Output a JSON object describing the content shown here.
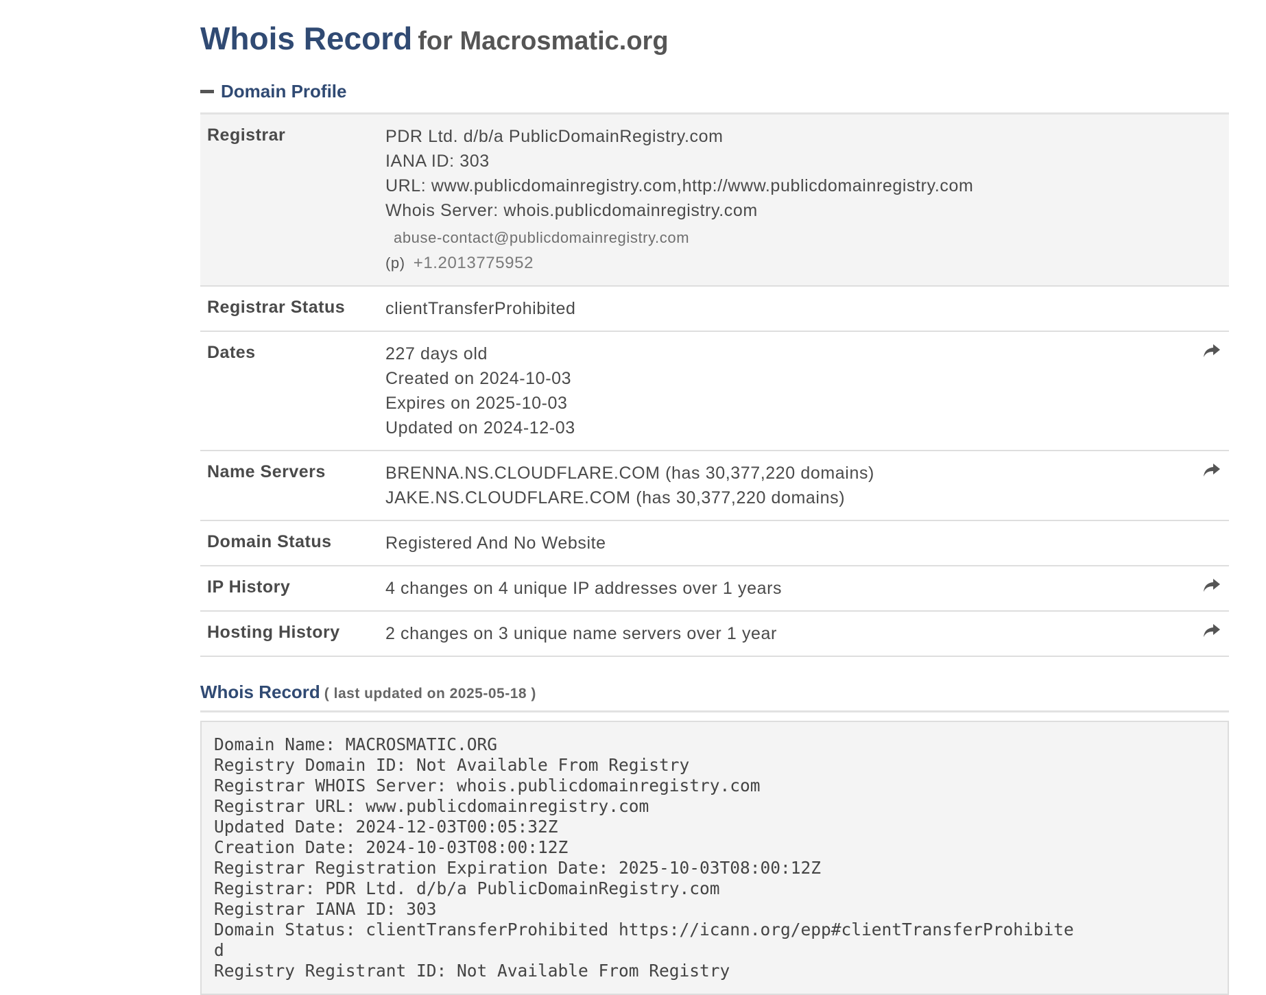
{
  "title": {
    "main": "Whois Record",
    "sub": "for Macrosmatic.org"
  },
  "profile_section": {
    "label": "Domain Profile",
    "rows": {
      "registrar": {
        "label": "Registrar",
        "name": "PDR Ltd. d/b/a PublicDomainRegistry.com",
        "iana": "IANA ID: 303",
        "url": "URL: www.publicdomainregistry.com,http://www.publicdomainregistry.com",
        "whois_server": "Whois Server: whois.publicdomainregistry.com",
        "email": "abuse-contact@publicdomainregistry.com",
        "phone_label": "(p)",
        "phone": "+1.2013775952"
      },
      "registrar_status": {
        "label": "Registrar Status",
        "value": "clientTransferProhibited"
      },
      "dates": {
        "label": "Dates",
        "age": "227 days old",
        "created": "Created on 2024-10-03",
        "expires": "Expires on 2025-10-03",
        "updated": "Updated on 2024-12-03"
      },
      "name_servers": {
        "label": "Name Servers",
        "ns1": "BRENNA.NS.CLOUDFLARE.COM (has 30,377,220 domains)",
        "ns2": "JAKE.NS.CLOUDFLARE.COM (has 30,377,220 domains)"
      },
      "domain_status": {
        "label": "Domain Status",
        "value": "Registered And No Website"
      },
      "ip_history": {
        "label": "IP History",
        "value": "4 changes on 4 unique IP addresses over 1 years"
      },
      "hosting_history": {
        "label": "Hosting History",
        "value": "2 changes on 3 unique name servers over 1 year"
      }
    }
  },
  "whois_section": {
    "title": "Whois Record",
    "updated": "( last updated on 2025-05-18 )",
    "raw_lines": [
      "Domain Name: MACROSMATIC.ORG",
      "Registry Domain ID: Not Available From Registry",
      "Registrar WHOIS Server: whois.publicdomainregistry.com",
      "Registrar URL: www.publicdomainregistry.com",
      "Updated Date: 2024-12-03T00:05:32Z",
      "Creation Date: 2024-10-03T08:00:12Z",
      "Registrar Registration Expiration Date: 2025-10-03T08:00:12Z",
      "Registrar: PDR Ltd. d/b/a PublicDomainRegistry.com",
      "Registrar IANA ID: 303",
      "Domain Status: clientTransferProhibited https://icann.org/epp#clientTransferProhibite",
      "d",
      "Registry Registrant ID: Not Available From Registry"
    ]
  },
  "icons": {
    "collapse": "minus-icon",
    "share": "share-arrow-icon"
  },
  "colors": {
    "heading": "#304a73",
    "text": "#4a4a4a",
    "row_shade": "#f4f4f4",
    "divider": "#dedede"
  }
}
